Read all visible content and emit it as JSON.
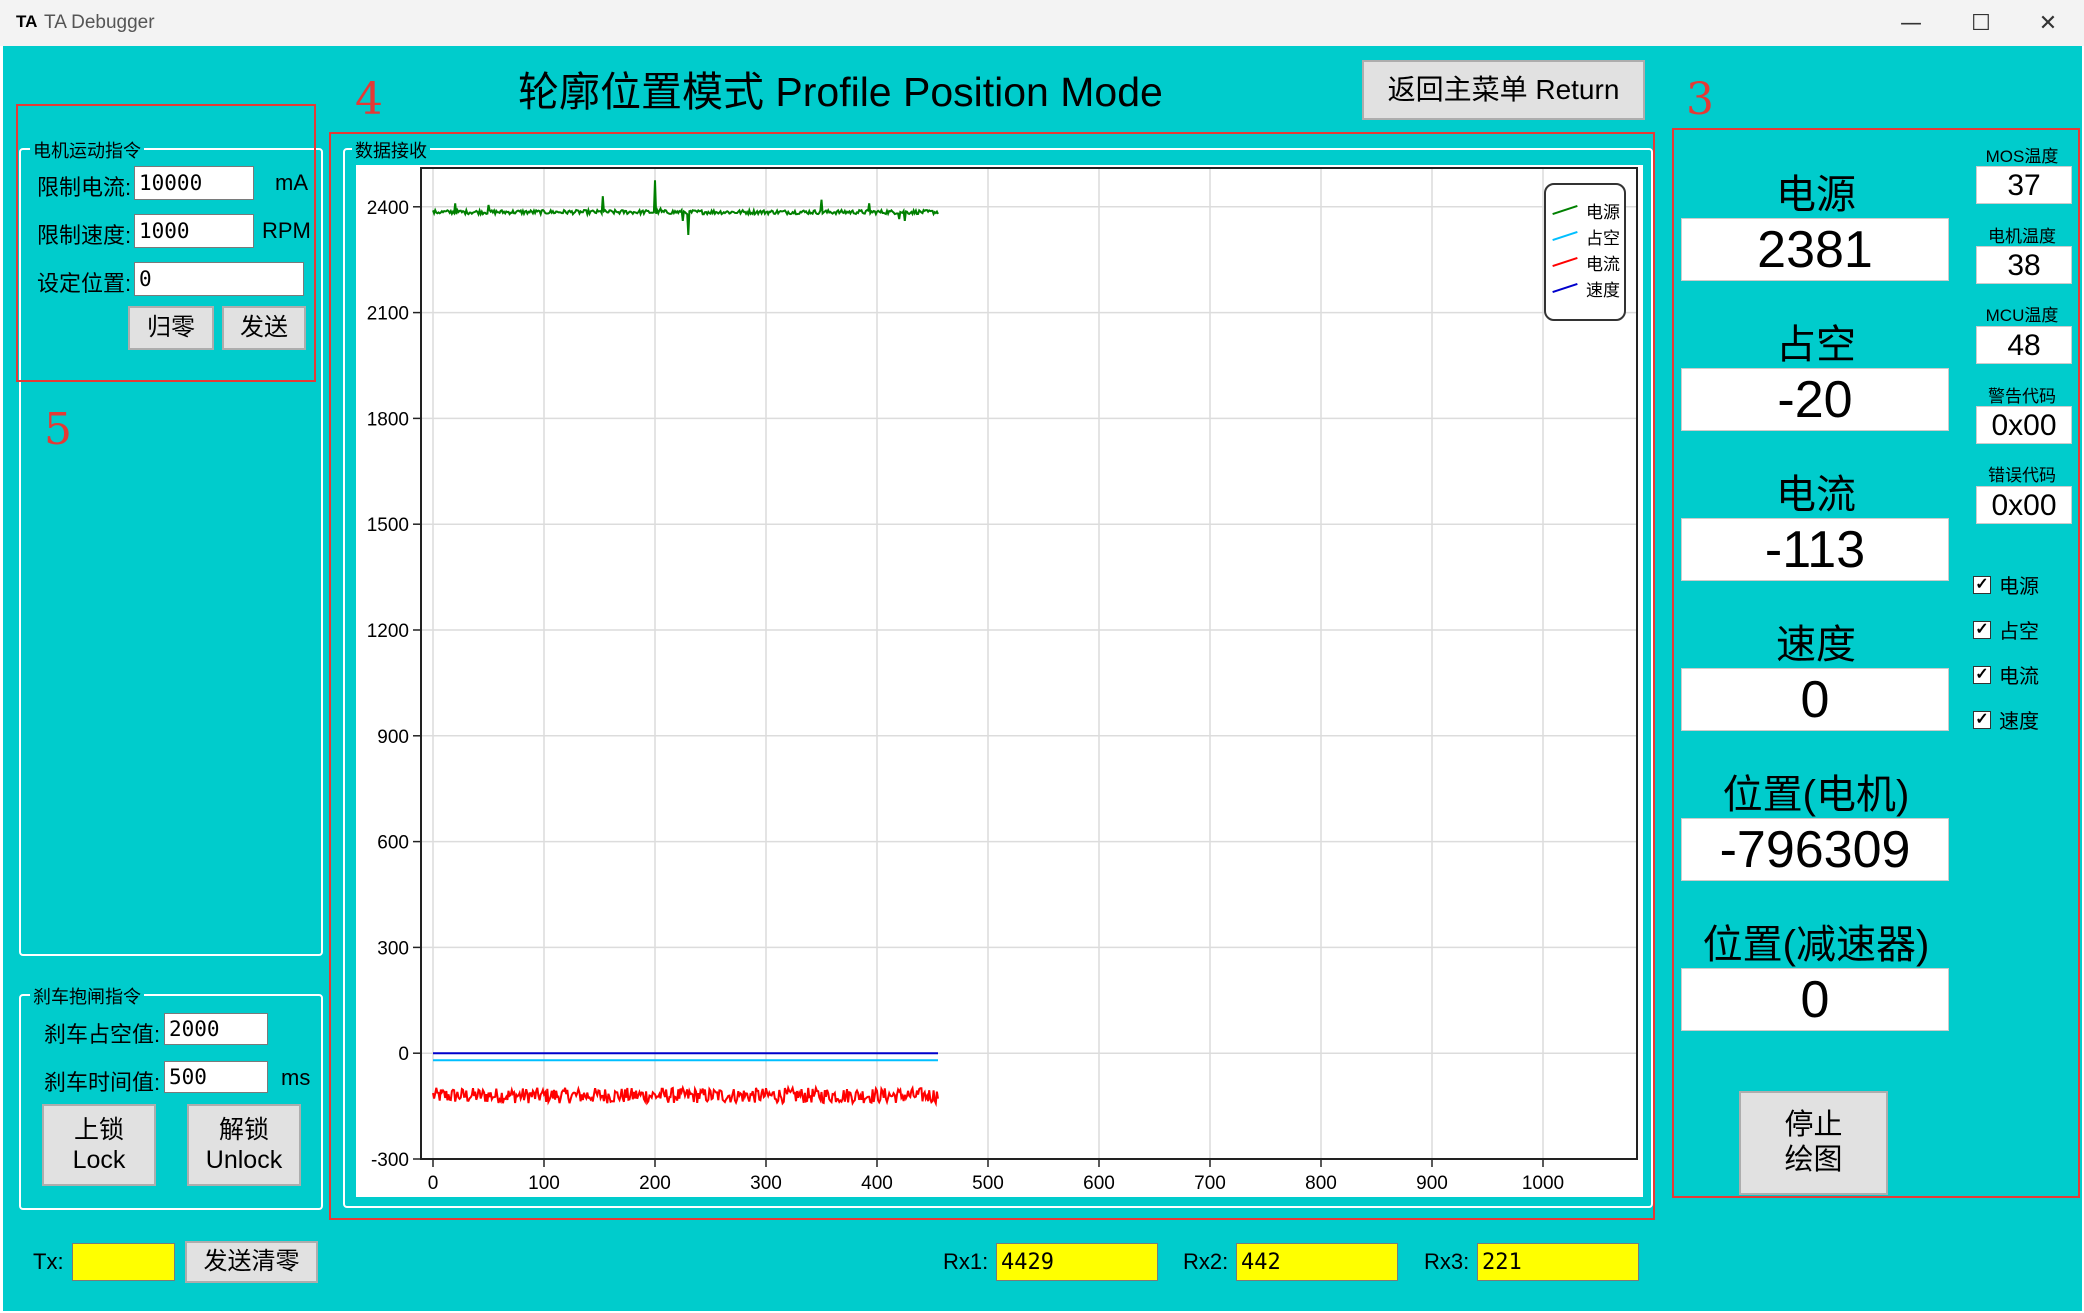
{
  "window": {
    "logo": "TA",
    "title": "TA Debugger",
    "minimize_glyph": "—",
    "maximize_glyph": "☐",
    "close_glyph": "✕"
  },
  "header": {
    "title": "轮廓位置模式 Profile Position Mode",
    "return_button": "返回主菜单 Return"
  },
  "annotations": [
    "5",
    "4",
    "3"
  ],
  "motor_cmd": {
    "group_title": "电机运动指令",
    "current_limit_label": "限制电流:",
    "current_limit_value": "10000",
    "current_unit": "mA",
    "speed_limit_label": "限制速度:",
    "speed_limit_value": "1000",
    "speed_unit": "RPM",
    "position_label": "设定位置:",
    "position_value": "0",
    "zero_button": "归零",
    "send_button": "发送"
  },
  "brake_cmd": {
    "group_title": "刹车抱闸指令",
    "duty_label": "刹车占空值:",
    "duty_value": "2000",
    "time_label": "刹车时间值:",
    "time_value": "500",
    "time_unit": "ms",
    "lock_button_cn": "上锁",
    "lock_button_en": "Lock",
    "unlock_button_cn": "解锁",
    "unlock_button_en": "Unlock"
  },
  "data_receive": {
    "group_title": "数据接收"
  },
  "status": {
    "tx_label": "Tx:",
    "tx_value": "",
    "clear_button": "发送清零",
    "rx1_label": "Rx1:",
    "rx1_value": "4429",
    "rx2_label": "Rx2:",
    "rx2_value": "442",
    "rx3_label": "Rx3:",
    "rx3_value": "221"
  },
  "readouts": {
    "power_label": "电源",
    "power_value": "2381",
    "duty_label": "占空",
    "duty_value": "-20",
    "current_label": "电流",
    "current_value": "-113",
    "speed_label": "速度",
    "speed_value": "0",
    "pos_motor_label": "位置(电机)",
    "pos_motor_value": "-796309",
    "pos_reducer_label": "位置(减速器)",
    "pos_reducer_value": "0"
  },
  "temps": {
    "mos_label": "MOS温度",
    "mos_value": "37",
    "motor_label": "电机温度",
    "motor_value": "38",
    "mcu_label": "MCU温度",
    "mcu_value": "48",
    "warning_label": "警告代码",
    "warning_value": "0x00",
    "error_label": "错误代码",
    "error_value": "0x00"
  },
  "checkboxes": [
    {
      "label": "电源",
      "checked": true
    },
    {
      "label": "占空",
      "checked": true
    },
    {
      "label": "电流",
      "checked": true
    },
    {
      "label": "速度",
      "checked": true
    }
  ],
  "stop_button": {
    "line1": "停止",
    "line2": "绘图"
  },
  "colors": {
    "background": "#00cccc",
    "power": "#008000",
    "duty": "#00bfff",
    "current": "#ff0000",
    "speed": "#0000cc",
    "annotation": "#e53935",
    "counter_bg": "#ffff00"
  },
  "chart_data": {
    "type": "line",
    "xlim": [
      0,
      1000
    ],
    "ylim": [
      -300,
      2400
    ],
    "x_ticks": [
      0,
      100,
      200,
      300,
      400,
      500,
      600,
      700,
      800,
      900,
      1000
    ],
    "y_ticks": [
      -300,
      0,
      300,
      600,
      900,
      1200,
      1500,
      1800,
      2100,
      2400
    ],
    "grid": true,
    "legend_position": "top-right",
    "x_data_range": [
      0,
      455
    ],
    "series": [
      {
        "name": "电源",
        "color": "#008000",
        "level": 2385,
        "noise": 6,
        "spikes": [
          [
            20,
            2410
          ],
          [
            50,
            2405
          ],
          [
            153,
            2430
          ],
          [
            200,
            2475
          ],
          [
            205,
            2395
          ],
          [
            225,
            2360
          ],
          [
            230,
            2320
          ],
          [
            350,
            2420
          ],
          [
            393,
            2410
          ],
          [
            420,
            2365
          ],
          [
            425,
            2360
          ]
        ]
      },
      {
        "name": "占空",
        "color": "#00bfff",
        "level": -20,
        "noise": 0,
        "spikes": []
      },
      {
        "name": "电流",
        "color": "#ff0000",
        "level": -120,
        "noise": 22,
        "spikes": []
      },
      {
        "name": "速度",
        "color": "#0000cc",
        "level": 0,
        "noise": 0,
        "spikes": []
      }
    ]
  }
}
